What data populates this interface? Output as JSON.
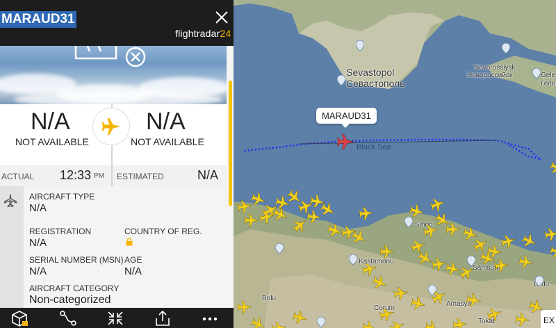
{
  "flight": {
    "callsign": "MARAUD31",
    "brand": {
      "main": "flightradar",
      "num": "24"
    }
  },
  "route": {
    "origin": {
      "code": "N/A",
      "name": "NOT AVAILABLE"
    },
    "destination": {
      "code": "N/A",
      "name": "NOT AVAILABLE"
    }
  },
  "times": {
    "actual_label": "ACTUAL",
    "actual_time": "12:33",
    "actual_ampm": "PM",
    "estimated_label": "ESTIMATED",
    "estimated_value": "N/A"
  },
  "aircraft": {
    "type_label": "AIRCRAFT TYPE",
    "type_value": "N/A",
    "registration_label": "REGISTRATION",
    "registration_value": "N/A",
    "country_label": "COUNTRY OF REG.",
    "msn_label": "SERIAL NUMBER (MSN)",
    "msn_value": "N/A",
    "age_label": "AGE",
    "age_value": "N/A",
    "category_label": "AIRCRAFT CATEGORY",
    "category_value": "Non-categorized"
  },
  "map": {
    "callout": "MARAUD31",
    "cities": {
      "sevastopol_lat": "Sevastopol",
      "sevastopol_cyr": "Севастополь",
      "novorossiysk_lat": "Novorossiysk",
      "novorossiysk_cyr": "Новороссийск",
      "gele": "Gele",
      "geln": "Гелен",
      "black_sea": "Black Sea",
      "sinop": "Sinop",
      "kastamonu": "Kastamonu",
      "samsun": "Samsun",
      "ordu": "Ordu",
      "bolu": "Bolu",
      "corum": "Corum",
      "amasya": "Amasya",
      "tokat": "Tokat"
    },
    "ex_label": "EX"
  },
  "colors": {
    "accent_yellow": "#f5b400",
    "plane_traffic": "#f3cf1d",
    "selected_plane": "#e0404a",
    "track": "#1a2ef0",
    "callsign_bg": "#2f69b3"
  },
  "icons": {
    "close": "close-icon",
    "plane": "airplane-icon",
    "lock": "lock-icon",
    "toolbar": [
      "3d-view-icon",
      "route-icon",
      "fit-view-icon",
      "share-icon",
      "more-icon"
    ]
  }
}
